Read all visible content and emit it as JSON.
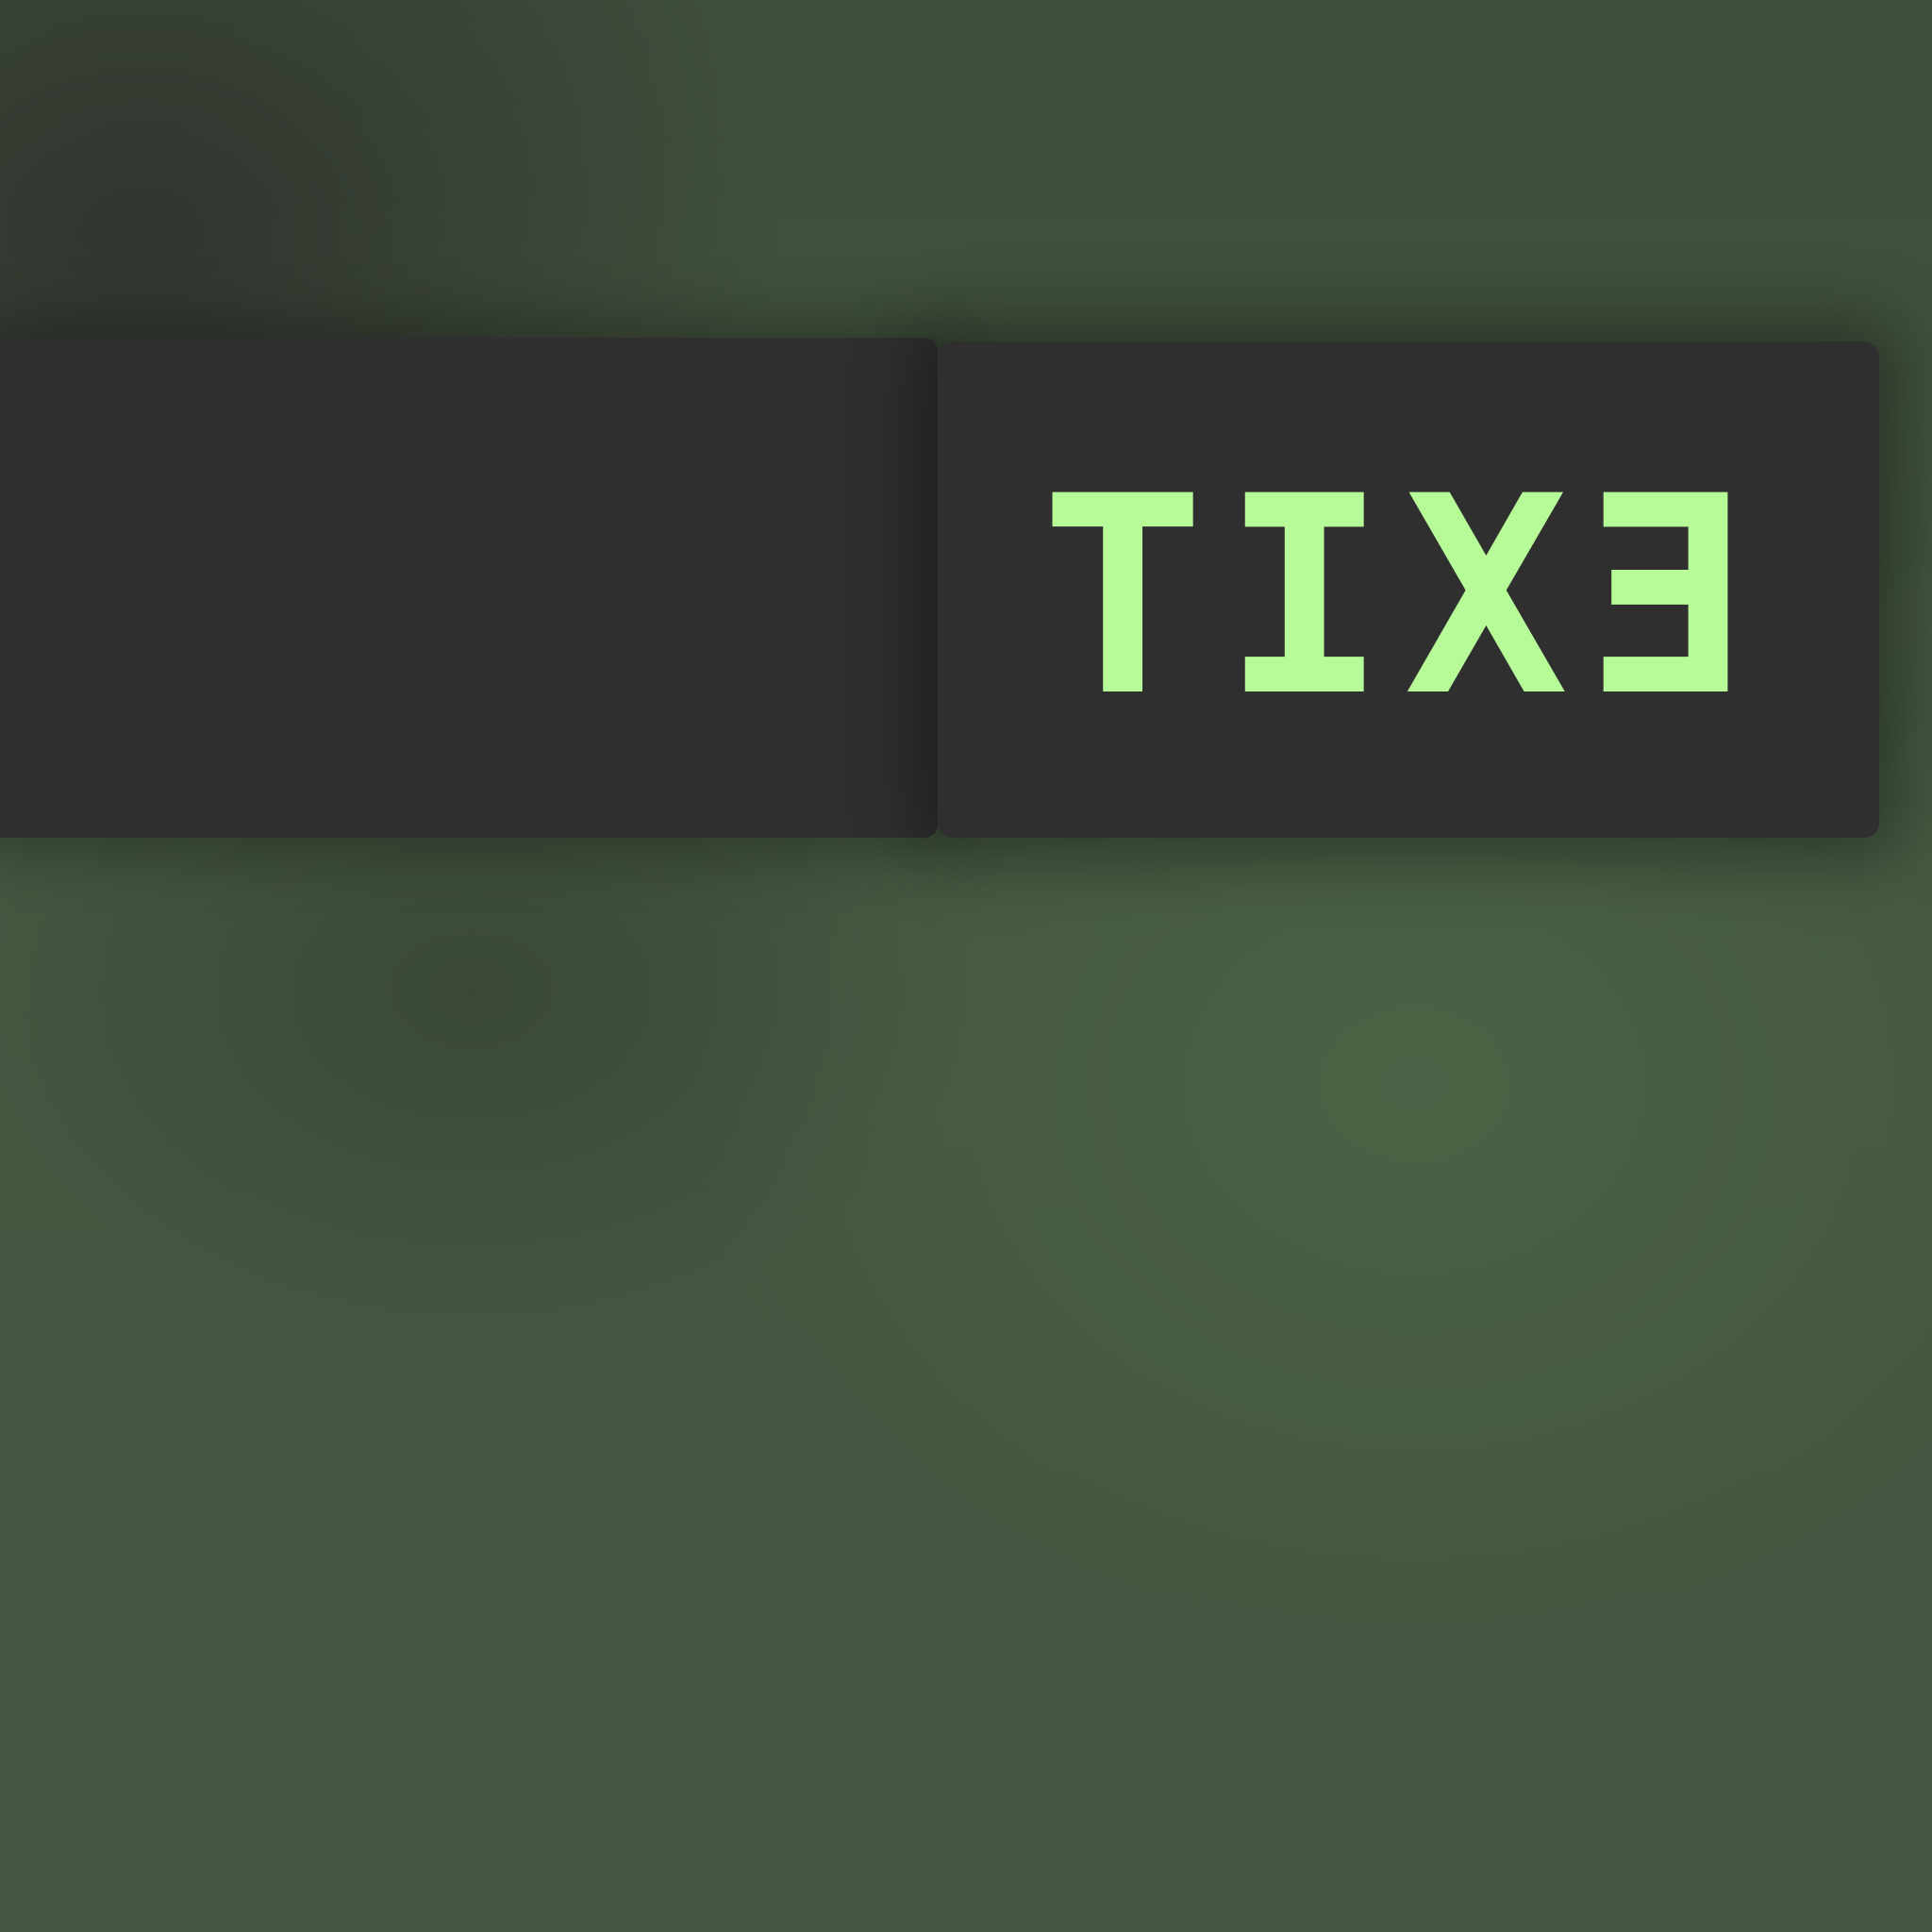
{
  "sign": {
    "text": "EXIT",
    "mirrored": true,
    "text_color": "#b6fb98",
    "panel_color": "#2f2f2f",
    "background_color": "#44573f"
  }
}
